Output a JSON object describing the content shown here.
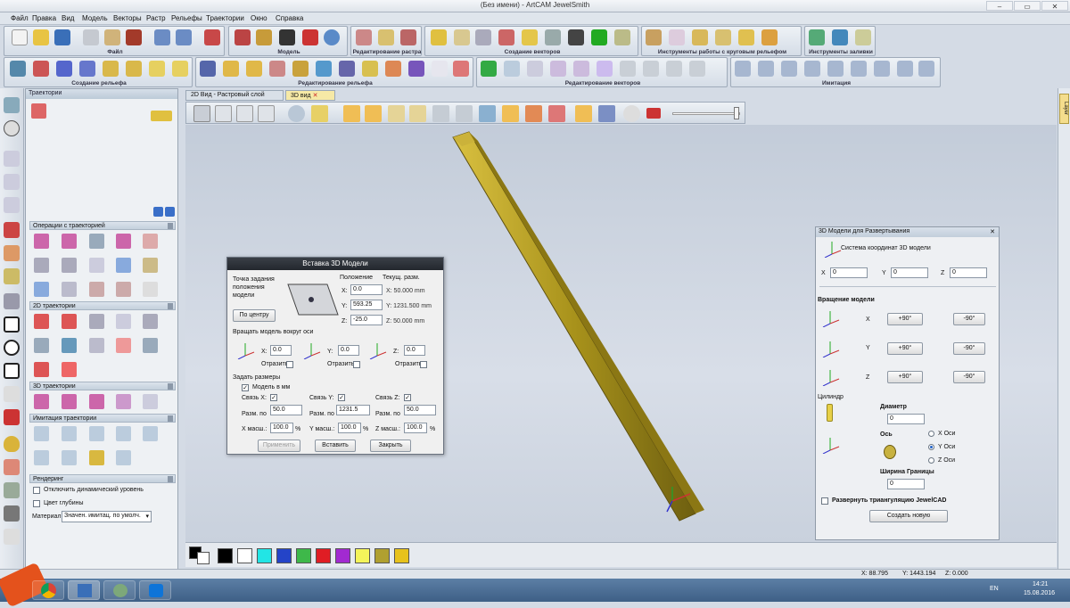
{
  "window": {
    "title": "(Без имени) - ArtCAM JewelSmith"
  },
  "menu": [
    "Файл",
    "Правка",
    "Вид",
    "Модель",
    "Векторы",
    "Растр",
    "Рельефы",
    "Траектории",
    "Окно",
    "Справка"
  ],
  "ribbon_groups": {
    "file": "Файл",
    "model": "Модель",
    "raster_edit": "Редактирование растра",
    "create_vectors": "Создание векторов",
    "rotary": "Инструменты работы с круговым рельефом",
    "fill": "Инструменты заливки",
    "create_relief": "Создание рельефа",
    "relief_edit": "Редактирование рельефа",
    "vector_edit": "Редактирование векторов",
    "imitation": "Имитация"
  },
  "left_panel": {
    "title": "Траектории",
    "sections": {
      "ops": "Операции с траекторией",
      "t2d": "2D траектории",
      "t3d": "3D траектории",
      "imit": "Имитация траектории",
      "render": "Рендеринг"
    },
    "render": {
      "disable_dynamic": "Отключить динамический уровень",
      "depth_color": "Цвет глубины",
      "material_label": "Материал",
      "material_value": "Значен. имитац. по умолч."
    }
  },
  "tabs": {
    "tab1": "2D Вид - Растровый слой",
    "tab2": "3D вид"
  },
  "insert_dialog": {
    "title": "Вставка 3D Модели",
    "anchor_label": "Точка задания положения модели",
    "center_button": "По центру",
    "position_label": "Положение",
    "current_size_label": "Текущ. разм.",
    "pos": {
      "x": "0.0",
      "y": "593.25",
      "z": "-25.0"
    },
    "size": {
      "x": "X: 50.000 mm",
      "y": "Y: 1231.500 mm",
      "z": "Z: 50.000 mm"
    },
    "rotate_label": "Вращать модель вокруг оси",
    "rot": {
      "x": "0.0",
      "y": "0.0",
      "z": "0.0"
    },
    "mirror_label": "Отразить",
    "set_size_label": "Задать размеры",
    "model_in_mm": "Модель в мм",
    "link_x": "Связь X:",
    "link_y": "Связь Y:",
    "link_z": "Связь Z:",
    "size_label": "Разм. по",
    "dims": {
      "x": "50.0",
      "y": "1231.5",
      "z": "50.0"
    },
    "scale_x_label": "X масш.:",
    "scale_y_label": "Y масш.:",
    "scale_z_label": "Z масш.:",
    "scale": {
      "x": "100.0",
      "y": "100.0",
      "z": "100.0"
    },
    "percent": "%",
    "apply": "Применить",
    "insert": "Вставить",
    "close": "Закрыть",
    "axis_x": "X:",
    "axis_y": "Y:",
    "axis_z": "Z:"
  },
  "right_panel": {
    "title": "3D Модели для Развертывания",
    "coord_label": "Система координат 3D модели",
    "coords": {
      "x": "0",
      "y": "0",
      "z": "0"
    },
    "x_lbl": "X",
    "y_lbl": "Y",
    "z_lbl": "Z",
    "rotation_label": "Вращение модели",
    "plus90": "+90°",
    "minus90": "-90°",
    "cylinder_label": "Цилиндр",
    "diameter_label": "Диаметр",
    "diameter_value": "0",
    "axis_label": "Ось",
    "axis_x": "X Оси",
    "axis_y": "Y Оси",
    "axis_z": "Z Оси",
    "border_width_label": "Ширина Границы",
    "border_width_value": "0",
    "unwrap_label": "Развернуть триангуляцию JewelCAD",
    "create_button": "Создать новую"
  },
  "right_strip": {
    "label": "Layer"
  },
  "statusbar": {
    "x": "X: 88.795",
    "y": "Y: 1443.194",
    "z": "Z: 0.000"
  },
  "taskbar": {
    "time": "14:21",
    "date": "15.08.2016",
    "lang": "EN"
  },
  "palette_colors": [
    "#000000",
    "#ffffff",
    "#22e5e5",
    "#2444c8",
    "#3eb84a",
    "#e01d24",
    "#a22ad1",
    "#f4f45a",
    "#b0a030",
    "#e7c21c"
  ]
}
